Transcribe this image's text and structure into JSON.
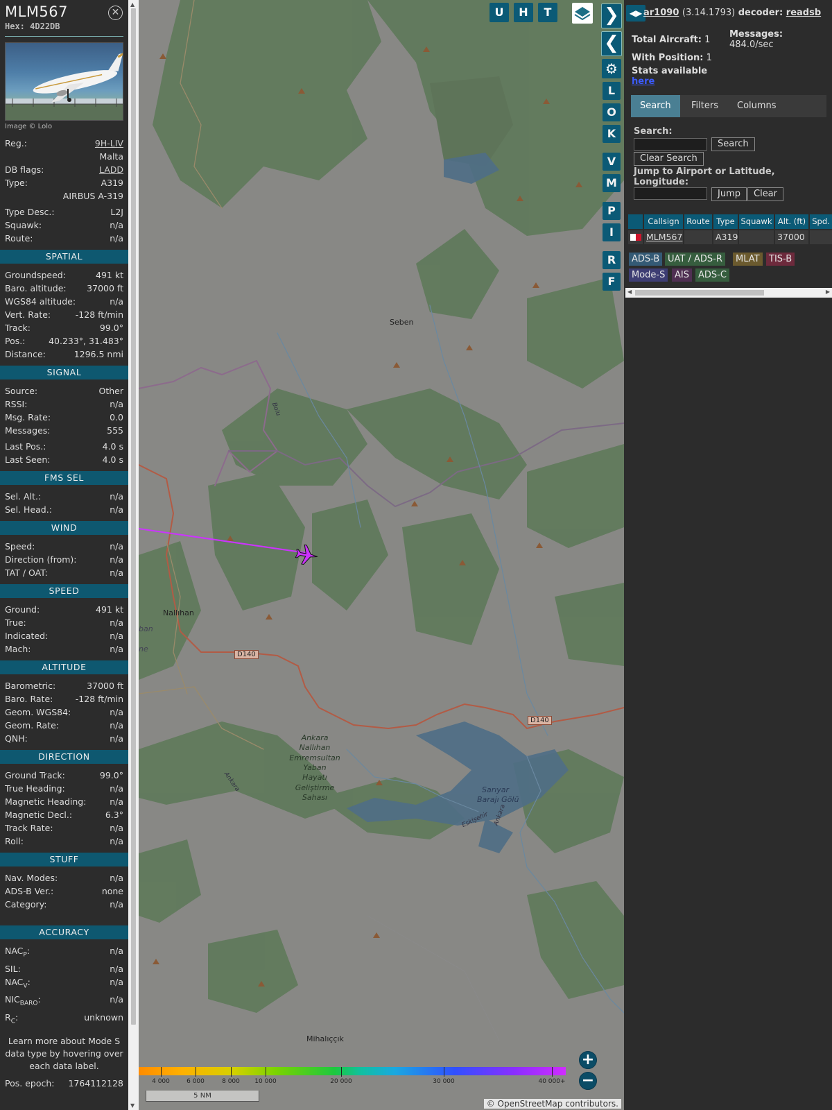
{
  "flight": {
    "callsign": "MLM567",
    "hex_label": "Hex:",
    "hex": "4D22DB"
  },
  "photo_credit": "Image © Lolo",
  "info": {
    "reg_label": "Reg.:",
    "reg": "9H-LIV",
    "country": "Malta",
    "dbflags_label": "DB flags:",
    "dbflags": "LADD",
    "type_label": "Type:",
    "type": "A319",
    "type_full": "AIRBUS A-319",
    "typedesc_label": "Type Desc.:",
    "typedesc": "L2J",
    "squawk_label": "Squawk:",
    "squawk": "n/a",
    "route_label": "Route:",
    "route": "n/a"
  },
  "sections": [
    {
      "title": "SPATIAL",
      "rows": [
        {
          "label": "Groundspeed:",
          "value": "491 kt"
        },
        {
          "label": "Baro. altitude:",
          "value": "37000 ft"
        },
        {
          "label": "WGS84 altitude:",
          "value": "n/a"
        },
        {
          "label": "Vert. Rate:",
          "value": "-128 ft/min"
        },
        {
          "label": "Track:",
          "value": "99.0°"
        },
        {
          "label": "Pos.:",
          "value": "40.233°, 31.483°"
        },
        {
          "label": "Distance:",
          "value": "1296.5 nmi"
        }
      ]
    },
    {
      "title": "SIGNAL",
      "rows": [
        {
          "label": "Source:",
          "value": "Other"
        },
        {
          "label": "RSSI:",
          "value": "n/a"
        },
        {
          "label": "Msg. Rate:",
          "value": "0.0"
        },
        {
          "label": "Messages:",
          "value": "555"
        },
        {
          "label": "Last Pos.:",
          "value": "4.0 s"
        },
        {
          "label": "Last Seen:",
          "value": "4.0 s"
        }
      ]
    },
    {
      "title": "FMS SEL",
      "rows": [
        {
          "label": "Sel. Alt.:",
          "value": "n/a"
        },
        {
          "label": "Sel. Head.:",
          "value": "n/a"
        }
      ]
    },
    {
      "title": "WIND",
      "rows": [
        {
          "label": "Speed:",
          "value": "n/a"
        },
        {
          "label": "Direction (from):",
          "value": "n/a"
        },
        {
          "label": "TAT / OAT:",
          "value": "n/a"
        }
      ]
    },
    {
      "title": "SPEED",
      "rows": [
        {
          "label": "Ground:",
          "value": "491 kt"
        },
        {
          "label": "True:",
          "value": "n/a"
        },
        {
          "label": "Indicated:",
          "value": "n/a"
        },
        {
          "label": "Mach:",
          "value": "n/a"
        }
      ]
    },
    {
      "title": "ALTITUDE",
      "rows": [
        {
          "label": "Barometric:",
          "value": "37000 ft"
        },
        {
          "label": "Baro. Rate:",
          "value": "-128 ft/min"
        },
        {
          "label": "Geom. WGS84:",
          "value": "n/a"
        },
        {
          "label": "Geom. Rate:",
          "value": "n/a"
        },
        {
          "label": "QNH:",
          "value": "n/a"
        }
      ]
    },
    {
      "title": "DIRECTION",
      "rows": [
        {
          "label": "Ground Track:",
          "value": "99.0°"
        },
        {
          "label": "True Heading:",
          "value": "n/a"
        },
        {
          "label": "Magnetic Heading:",
          "value": "n/a"
        },
        {
          "label": "Magnetic Decl.:",
          "value": "6.3°"
        },
        {
          "label": "Track Rate:",
          "value": "n/a"
        },
        {
          "label": "Roll:",
          "value": "n/a"
        }
      ]
    },
    {
      "title": "STUFF",
      "rows": [
        {
          "label": "Nav. Modes:",
          "value": "n/a"
        },
        {
          "label": "ADS-B Ver.:",
          "value": "none"
        },
        {
          "label": "Category:",
          "value": "n/a"
        }
      ]
    }
  ],
  "accuracy": {
    "title": "ACCURACY",
    "nacp_main": "NAC",
    "nacp_sub": "P",
    "nacp": "n/a",
    "sil_label": "SIL:",
    "sil": "n/a",
    "nacv_main": "NAC",
    "nacv_sub": "V",
    "nacv": "n/a",
    "nic_main": "NIC",
    "nic_sub": "BARO",
    "nic": "n/a",
    "rc_main": "R",
    "rc_sub": "C",
    "rc": "unknown"
  },
  "note": "Learn more about Mode S data type by hovering over each data label.",
  "epoch": {
    "label": "Pos. epoch:",
    "value": "1764112128"
  },
  "map": {
    "places": [
      "Seben",
      "Nallıhan",
      "Mihalıççık"
    ],
    "roads": [
      "D140",
      "D140"
    ],
    "rivers": [
      "Bolu",
      "Ankara",
      "Eskişehir",
      "Ankara"
    ],
    "reserve": [
      "Ankara",
      "Nallıhan",
      "Emremsultan",
      "Yaban",
      "Hayatı",
      "Geliştirme",
      "Sahası"
    ],
    "lake": [
      "Sarıyar",
      "Barajı Gölü"
    ],
    "edge_fragments": [
      "ban",
      "ne"
    ],
    "altitude_scale": [
      "4 000",
      "6 000",
      "8 000",
      "10 000",
      "20 000",
      "30 000",
      "40 000+"
    ],
    "scale": "5 NM",
    "attribution": "© OpenStreetMap contributors.",
    "toggle_buttons": [
      "U",
      "H",
      "T"
    ],
    "side_buttons": [
      "L",
      "O",
      "K",
      "V",
      "M",
      "P",
      "I",
      "R",
      "F"
    ],
    "zoom_in": "+",
    "zoom_out": "−",
    "colors": {
      "trail": "#cc33ff",
      "aircraft": "#cc33ff",
      "button": "#0b5a76"
    }
  },
  "right": {
    "app_name": "ar1090",
    "version": "(3.14.1793)",
    "decoder_label": "decoder:",
    "decoder": "readsb",
    "total_label": "Total Aircraft:",
    "total": "1",
    "messages_label": "Messages:",
    "messages": "484.0/sec",
    "withpos_label": "With Position:",
    "withpos": "1",
    "stats_text": "Stats available",
    "stats_link": "here",
    "tabs": [
      "Search",
      "Filters",
      "Columns"
    ],
    "search_label": "Search:",
    "search_button": "Search",
    "clear_search_button": "Clear Search",
    "jump_label_1": "Jump to Airport or Latitude,",
    "jump_label_2": "Longitude:",
    "jump_button": "Jump",
    "clear_button": "Clear",
    "table_headers": [
      "Callsign",
      "Route",
      "Type",
      "Squawk",
      "Alt. (ft)",
      "Spd."
    ],
    "table_row": {
      "callsign": "MLM567",
      "route": "",
      "type": "A319",
      "squawk": "",
      "alt": "37000",
      "spd": ""
    },
    "source_tags": [
      "ADS-B",
      "UAT / ADS-R",
      "MLAT",
      "TIS-B",
      "Mode-S",
      "AIS",
      "ADS-C"
    ]
  }
}
